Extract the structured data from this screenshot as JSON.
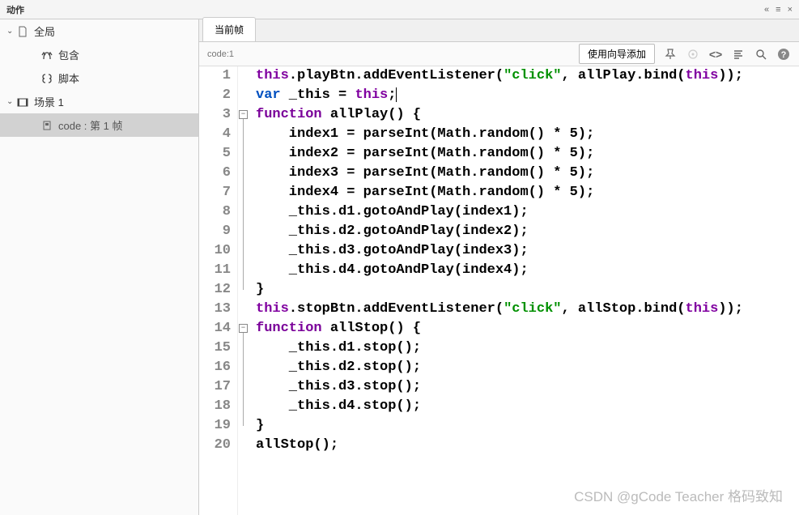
{
  "panel_title": "动作",
  "collapse_glyph": "«",
  "menu_glyph": "≡",
  "close_glyph": "×",
  "sidebar": {
    "items": [
      {
        "label": "全局",
        "level": 0,
        "chevron": "⌄",
        "icon": "document",
        "selected": false
      },
      {
        "label": "包含",
        "level": 1,
        "chevron": "",
        "icon": "script-include",
        "selected": false
      },
      {
        "label": "脚本",
        "level": 1,
        "chevron": "",
        "icon": "script",
        "selected": false
      },
      {
        "label": "场景 1",
        "level": 0,
        "chevron": "⌄",
        "icon": "scene",
        "selected": false
      },
      {
        "label": "code : 第 1 帧",
        "level": 1,
        "chevron": "",
        "icon": "frame",
        "selected": true
      }
    ]
  },
  "tab_label": "当前帧",
  "breadcrumb": "code:1",
  "wizard_label": "使用向导添加",
  "code": {
    "lines": [
      [
        {
          "t": "this",
          "c": "kw-this"
        },
        {
          "t": ".playBtn.addEventListener(",
          "c": "txt"
        },
        {
          "t": "\"click\"",
          "c": "str"
        },
        {
          "t": ", allPlay.bind(",
          "c": "txt"
        },
        {
          "t": "this",
          "c": "kw-this"
        },
        {
          "t": "));",
          "c": "txt"
        }
      ],
      [
        {
          "t": "var",
          "c": "kw-var"
        },
        {
          "t": " _this = ",
          "c": "txt"
        },
        {
          "t": "this",
          "c": "kw-this"
        },
        {
          "t": ";",
          "c": "txt"
        }
      ],
      [
        {
          "t": "function",
          "c": "kw-func"
        },
        {
          "t": " allPlay() {",
          "c": "txt"
        }
      ],
      [
        {
          "t": "    index1 = parseInt(Math.random() * 5);",
          "c": "txt"
        }
      ],
      [
        {
          "t": "    index2 = parseInt(Math.random() * 5);",
          "c": "txt"
        }
      ],
      [
        {
          "t": "    index3 = parseInt(Math.random() * 5);",
          "c": "txt"
        }
      ],
      [
        {
          "t": "    index4 = parseInt(Math.random() * 5);",
          "c": "txt"
        }
      ],
      [
        {
          "t": "    _this.d1.gotoAndPlay(index1);",
          "c": "txt"
        }
      ],
      [
        {
          "t": "    _this.d2.gotoAndPlay(index2);",
          "c": "txt"
        }
      ],
      [
        {
          "t": "    _this.d3.gotoAndPlay(index3);",
          "c": "txt"
        }
      ],
      [
        {
          "t": "    _this.d4.gotoAndPlay(index4);",
          "c": "txt"
        }
      ],
      [
        {
          "t": "}",
          "c": "txt"
        }
      ],
      [
        {
          "t": "this",
          "c": "kw-this"
        },
        {
          "t": ".stopBtn.addEventListener(",
          "c": "txt"
        },
        {
          "t": "\"click\"",
          "c": "str"
        },
        {
          "t": ", allStop.bind(",
          "c": "txt"
        },
        {
          "t": "this",
          "c": "kw-this"
        },
        {
          "t": "));",
          "c": "txt"
        }
      ],
      [
        {
          "t": "function",
          "c": "kw-func"
        },
        {
          "t": " allStop() {",
          "c": "txt"
        }
      ],
      [
        {
          "t": "    _this.d1.stop();",
          "c": "txt"
        }
      ],
      [
        {
          "t": "    _this.d2.stop();",
          "c": "txt"
        }
      ],
      [
        {
          "t": "    _this.d3.stop();",
          "c": "txt"
        }
      ],
      [
        {
          "t": "    _this.d4.stop();",
          "c": "txt"
        }
      ],
      [
        {
          "t": "}",
          "c": "txt"
        }
      ],
      [
        {
          "t": "allStop();",
          "c": "txt"
        }
      ]
    ],
    "fold_markers": [
      {
        "line": 3,
        "end": 12
      },
      {
        "line": 14,
        "end": 19
      }
    ],
    "cursor_line": 2
  },
  "watermark": "CSDN @gCode Teacher  格码致知"
}
